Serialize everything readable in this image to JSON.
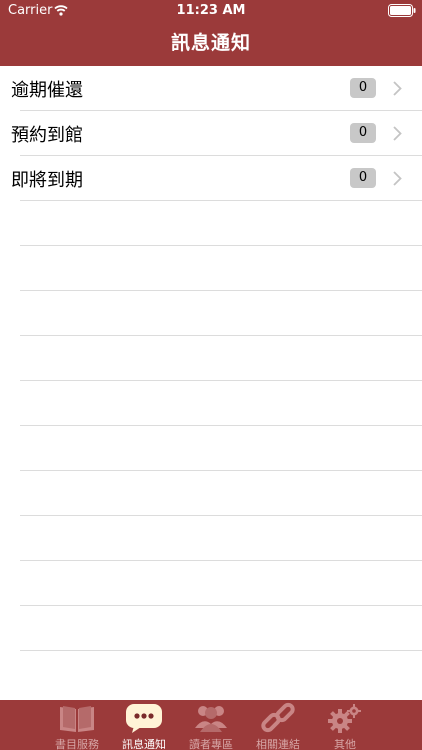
{
  "status_bar": {
    "carrier": "Carrier",
    "time": "11:23 AM"
  },
  "nav": {
    "title": "訊息通知"
  },
  "rows": [
    {
      "label": "逾期催還",
      "count": "0"
    },
    {
      "label": "預約到館",
      "count": "0"
    },
    {
      "label": "即將到期",
      "count": "0"
    }
  ],
  "tabs": [
    {
      "label": "書目服務",
      "icon": "book-icon"
    },
    {
      "label": "訊息通知",
      "icon": "message-icon",
      "active": true
    },
    {
      "label": "讀者專區",
      "icon": "people-icon"
    },
    {
      "label": "相關連結",
      "icon": "link-icon"
    },
    {
      "label": "其他",
      "icon": "gear-icon"
    }
  ],
  "colors": {
    "brand": "#9b3a3a",
    "tab_inactive": "#d7a6a6",
    "badge": "#c8c8c8"
  }
}
